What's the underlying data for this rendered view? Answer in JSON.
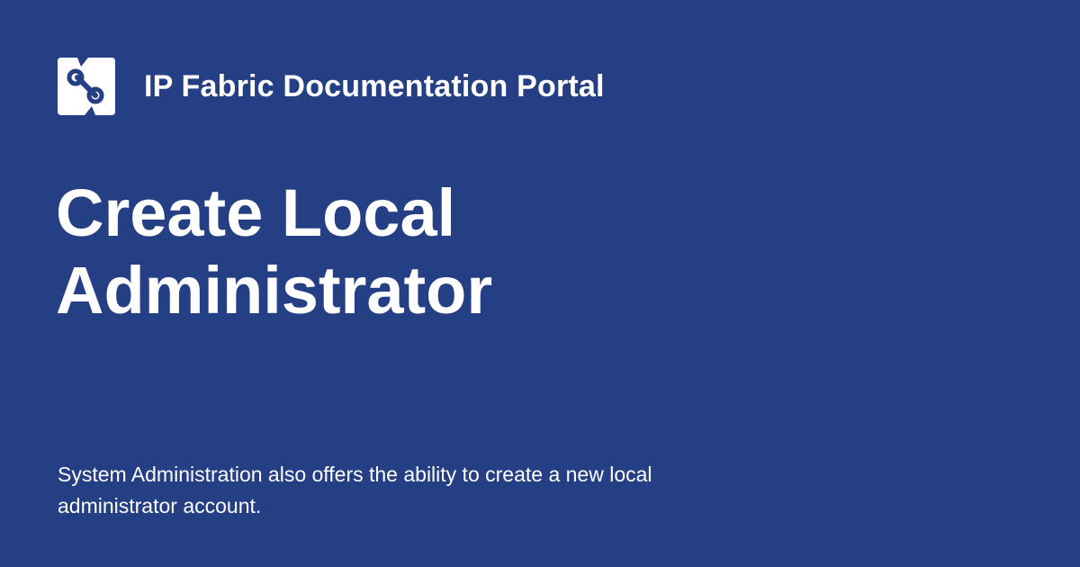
{
  "brand": {
    "logo_icon": "ip-fabric-logo-icon",
    "site_name": "IP Fabric Documentation Portal",
    "background_color": "#253f85",
    "text_color": "#ffffff"
  },
  "page": {
    "title_line1": "Create Local",
    "title_line2": "Administrator",
    "description": "System Administration also offers the ability to create a new local administrator account."
  }
}
